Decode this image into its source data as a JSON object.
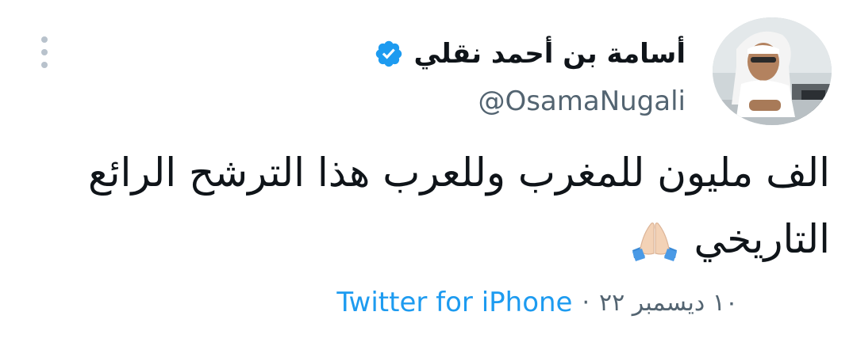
{
  "tweet": {
    "author": {
      "display_name": "أسامة بن أحمد نقلي",
      "handle": "@OsamaNugali",
      "verified": true,
      "avatar_icon": "profile-photo"
    },
    "text_lines": [
      "الف مليون للمغرب وللعرب هذا الترشح الرائع",
      "التاريخي"
    ],
    "emoji": "🙏🏻",
    "meta": {
      "date": "١٠ ديسمبر ٢٢",
      "separator": "·",
      "source": "Twitter for iPhone"
    },
    "more_icon": "more-options-vertical-icon"
  },
  "colors": {
    "accent": "#1d9bf0",
    "secondary_text": "#536471",
    "primary_text": "#0f1419"
  }
}
